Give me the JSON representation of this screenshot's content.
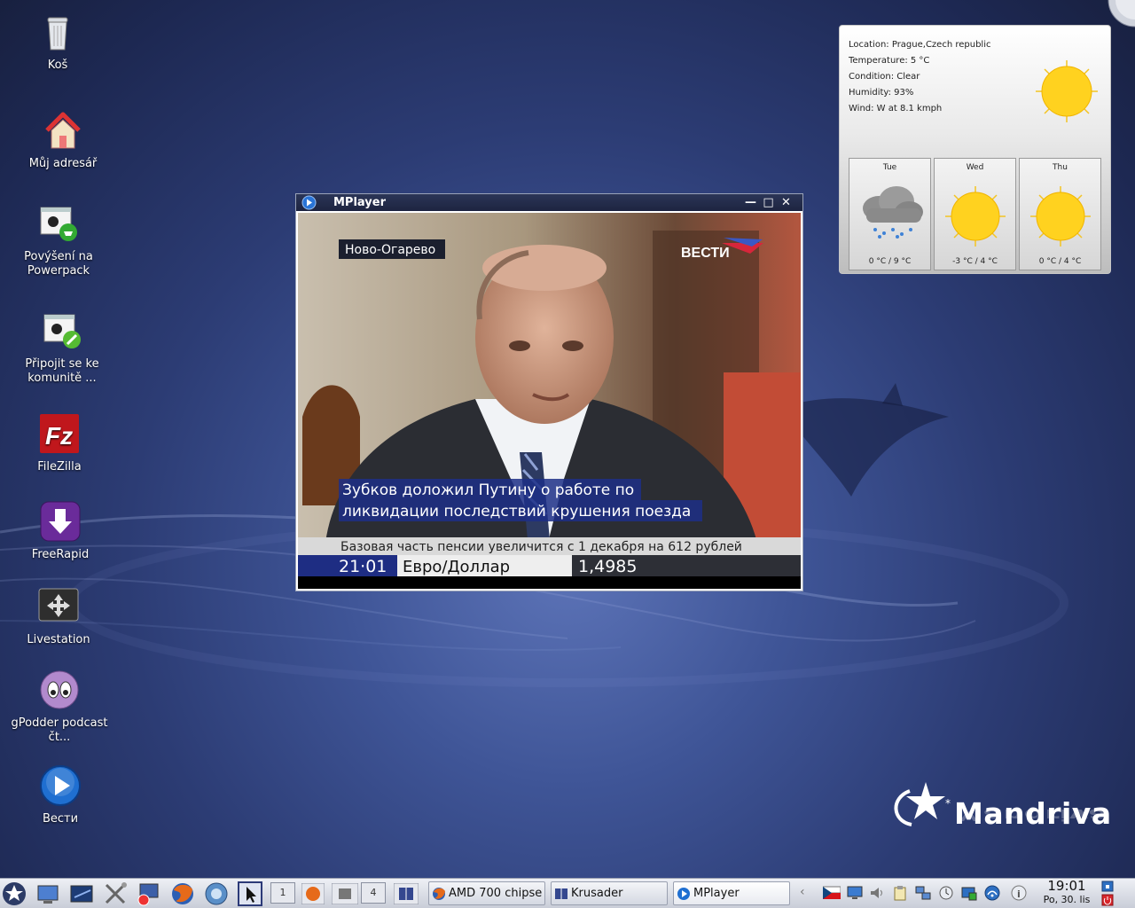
{
  "desktop": {
    "icons": [
      {
        "label": "Koš",
        "icon": "trash-icon"
      },
      {
        "label": "Můj adresář",
        "icon": "home-icon"
      },
      {
        "label": "Povýšení na Powerpack",
        "icon": "powerpack-upgrade-icon"
      },
      {
        "label": "Připojit se ke komunitě ...",
        "icon": "community-join-icon"
      },
      {
        "label": "FileZilla",
        "icon": "filezilla-icon"
      },
      {
        "label": "FreeRapid",
        "icon": "freerapid-icon"
      },
      {
        "label": "Livestation",
        "icon": "livestation-icon"
      },
      {
        "label": "gPodder podcast čt...",
        "icon": "gpodder-icon"
      },
      {
        "label": "Вести",
        "icon": "media-play-icon"
      }
    ],
    "logo": {
      "text": "Mandriva"
    }
  },
  "mplayer": {
    "title": "MPlayer",
    "video": {
      "location_tag": "Ново-Огарево",
      "channel_logo": "ВЕСТИ",
      "caption_line1": "Зубков доложил Путину о работе по",
      "caption_line2": "ликвидации последствий крушения поезда",
      "ticker": "Базовая часть пенсии увеличится с 1 декабря на 612 рублей",
      "time": "21·01",
      "rate_label": "Евро/Доллар",
      "rate_value": "1,4985"
    }
  },
  "weather": {
    "location": "Location: Prague,Czech republic",
    "temperature": "Temperature: 5 °C",
    "condition": "Condition: Clear",
    "humidity": "Humidity: 93%",
    "wind": "Wind: W at 8.1 kmph",
    "current_icon": "sun-icon",
    "forecast": [
      {
        "day": "Tue",
        "temp": "0 °C / 9 °C",
        "icon": "rain-cloud-icon"
      },
      {
        "day": "Wed",
        "temp": "-3 °C / 4 °C",
        "icon": "sun-icon"
      },
      {
        "day": "Thu",
        "temp": "0 °C / 4 °C",
        "icon": "sun-icon"
      }
    ]
  },
  "taskbar": {
    "pager": [
      "1",
      "4"
    ],
    "tasks": [
      {
        "label": "AMD 700 chipse",
        "icon": "firefox-icon"
      },
      {
        "label": "Krusader",
        "icon": "krusader-icon"
      },
      {
        "label": "MPlayer",
        "icon": "mplayer-icon"
      }
    ],
    "clock": {
      "time": "19:01",
      "date": "Po, 30. lis"
    }
  }
}
